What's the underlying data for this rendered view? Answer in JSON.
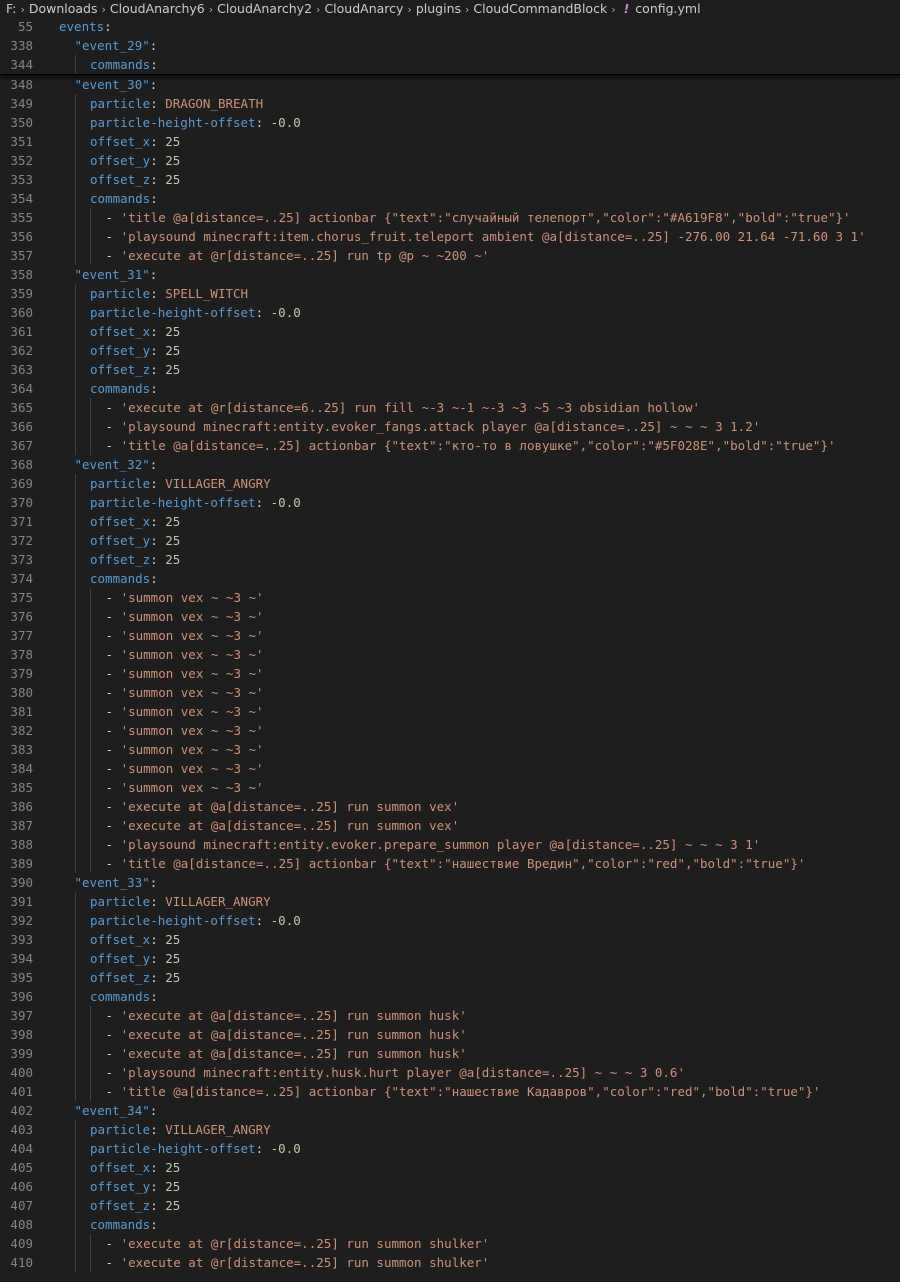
{
  "breadcrumb": {
    "items": [
      "F:",
      "Downloads",
      "CloudAnarchy6",
      "CloudAnarchy2",
      "CloudAnarcy",
      "plugins",
      "CloudCommandBlock"
    ],
    "file_icon": "!",
    "file_name": "config.yml"
  },
  "sticky_lines": [
    {
      "num": "55",
      "indent": 0,
      "parts": [
        {
          "t": "events",
          "c": "k"
        },
        {
          "t": ":",
          "c": "p"
        }
      ]
    },
    {
      "num": "338",
      "indent": 1,
      "parts": [
        {
          "t": "\"event_29\"",
          "c": "k"
        },
        {
          "t": ":",
          "c": "p"
        }
      ]
    },
    {
      "num": "344",
      "indent": 2,
      "parts": [
        {
          "t": "commands",
          "c": "k"
        },
        {
          "t": ":",
          "c": "p"
        }
      ]
    }
  ],
  "lines": [
    {
      "num": "348",
      "indent": 1,
      "parts": [
        {
          "t": "\"event_30\"",
          "c": "k"
        },
        {
          "t": ":",
          "c": "p"
        }
      ]
    },
    {
      "num": "349",
      "indent": 2,
      "parts": [
        {
          "t": "particle",
          "c": "k"
        },
        {
          "t": ": ",
          "c": "p"
        },
        {
          "t": "DRAGON_BREATH",
          "c": "s"
        }
      ]
    },
    {
      "num": "350",
      "indent": 2,
      "parts": [
        {
          "t": "particle-height-offset",
          "c": "k"
        },
        {
          "t": ": ",
          "c": "p"
        },
        {
          "t": "-0.0",
          "c": "n"
        }
      ]
    },
    {
      "num": "351",
      "indent": 2,
      "parts": [
        {
          "t": "offset_x",
          "c": "k"
        },
        {
          "t": ": ",
          "c": "p"
        },
        {
          "t": "25",
          "c": "n"
        }
      ]
    },
    {
      "num": "352",
      "indent": 2,
      "parts": [
        {
          "t": "offset_y",
          "c": "k"
        },
        {
          "t": ": ",
          "c": "p"
        },
        {
          "t": "25",
          "c": "n"
        }
      ]
    },
    {
      "num": "353",
      "indent": 2,
      "parts": [
        {
          "t": "offset_z",
          "c": "k"
        },
        {
          "t": ": ",
          "c": "p"
        },
        {
          "t": "25",
          "c": "n"
        }
      ]
    },
    {
      "num": "354",
      "indent": 2,
      "parts": [
        {
          "t": "commands",
          "c": "k"
        },
        {
          "t": ":",
          "c": "p"
        }
      ]
    },
    {
      "num": "355",
      "indent": 3,
      "parts": [
        {
          "t": "- ",
          "c": "p"
        },
        {
          "t": "'title @a[distance=..25] actionbar {\"text\":\"случайный телепорт\",\"color\":\"#A619F8\",\"bold\":\"true\"}'",
          "c": "s"
        }
      ]
    },
    {
      "num": "356",
      "indent": 3,
      "parts": [
        {
          "t": "- ",
          "c": "p"
        },
        {
          "t": "'playsound minecraft:item.chorus_fruit.teleport ambient @a[distance=..25] -276.00 21.64 -71.60 3 1'",
          "c": "s"
        }
      ]
    },
    {
      "num": "357",
      "indent": 3,
      "parts": [
        {
          "t": "- ",
          "c": "p"
        },
        {
          "t": "'execute at @r[distance=..25] run tp @p ~ ~200 ~'",
          "c": "s"
        }
      ]
    },
    {
      "num": "358",
      "indent": 1,
      "parts": [
        {
          "t": "\"event_31\"",
          "c": "k"
        },
        {
          "t": ":",
          "c": "p"
        }
      ]
    },
    {
      "num": "359",
      "indent": 2,
      "parts": [
        {
          "t": "particle",
          "c": "k"
        },
        {
          "t": ": ",
          "c": "p"
        },
        {
          "t": "SPELL_WITCH",
          "c": "s"
        }
      ]
    },
    {
      "num": "360",
      "indent": 2,
      "parts": [
        {
          "t": "particle-height-offset",
          "c": "k"
        },
        {
          "t": ": ",
          "c": "p"
        },
        {
          "t": "-0.0",
          "c": "n"
        }
      ]
    },
    {
      "num": "361",
      "indent": 2,
      "parts": [
        {
          "t": "offset_x",
          "c": "k"
        },
        {
          "t": ": ",
          "c": "p"
        },
        {
          "t": "25",
          "c": "n"
        }
      ]
    },
    {
      "num": "362",
      "indent": 2,
      "parts": [
        {
          "t": "offset_y",
          "c": "k"
        },
        {
          "t": ": ",
          "c": "p"
        },
        {
          "t": "25",
          "c": "n"
        }
      ]
    },
    {
      "num": "363",
      "indent": 2,
      "parts": [
        {
          "t": "offset_z",
          "c": "k"
        },
        {
          "t": ": ",
          "c": "p"
        },
        {
          "t": "25",
          "c": "n"
        }
      ]
    },
    {
      "num": "364",
      "indent": 2,
      "parts": [
        {
          "t": "commands",
          "c": "k"
        },
        {
          "t": ":",
          "c": "p"
        }
      ]
    },
    {
      "num": "365",
      "indent": 3,
      "parts": [
        {
          "t": "- ",
          "c": "p"
        },
        {
          "t": "'execute at @r[distance=6..25] run fill ~-3 ~-1 ~-3 ~3 ~5 ~3 obsidian hollow'",
          "c": "s"
        }
      ]
    },
    {
      "num": "366",
      "indent": 3,
      "parts": [
        {
          "t": "- ",
          "c": "p"
        },
        {
          "t": "'playsound minecraft:entity.evoker_fangs.attack player @a[distance=..25] ~ ~ ~ 3 1.2'",
          "c": "s"
        }
      ]
    },
    {
      "num": "367",
      "indent": 3,
      "parts": [
        {
          "t": "- ",
          "c": "p"
        },
        {
          "t": "'title @a[distance=..25] actionbar {\"text\":\"кто-то в ловушке\",\"color\":\"#5F028E\",\"bold\":\"true\"}'",
          "c": "s"
        }
      ]
    },
    {
      "num": "368",
      "indent": 1,
      "parts": [
        {
          "t": "\"event_32\"",
          "c": "k"
        },
        {
          "t": ":",
          "c": "p"
        }
      ]
    },
    {
      "num": "369",
      "indent": 2,
      "parts": [
        {
          "t": "particle",
          "c": "k"
        },
        {
          "t": ": ",
          "c": "p"
        },
        {
          "t": "VILLAGER_ANGRY",
          "c": "s"
        }
      ]
    },
    {
      "num": "370",
      "indent": 2,
      "parts": [
        {
          "t": "particle-height-offset",
          "c": "k"
        },
        {
          "t": ": ",
          "c": "p"
        },
        {
          "t": "-0.0",
          "c": "n"
        }
      ]
    },
    {
      "num": "371",
      "indent": 2,
      "parts": [
        {
          "t": "offset_x",
          "c": "k"
        },
        {
          "t": ": ",
          "c": "p"
        },
        {
          "t": "25",
          "c": "n"
        }
      ]
    },
    {
      "num": "372",
      "indent": 2,
      "parts": [
        {
          "t": "offset_y",
          "c": "k"
        },
        {
          "t": ": ",
          "c": "p"
        },
        {
          "t": "25",
          "c": "n"
        }
      ]
    },
    {
      "num": "373",
      "indent": 2,
      "parts": [
        {
          "t": "offset_z",
          "c": "k"
        },
        {
          "t": ": ",
          "c": "p"
        },
        {
          "t": "25",
          "c": "n"
        }
      ]
    },
    {
      "num": "374",
      "indent": 2,
      "parts": [
        {
          "t": "commands",
          "c": "k"
        },
        {
          "t": ":",
          "c": "p"
        }
      ]
    },
    {
      "num": "375",
      "indent": 3,
      "parts": [
        {
          "t": "- ",
          "c": "p"
        },
        {
          "t": "'summon vex ~ ~3 ~'",
          "c": "s"
        }
      ]
    },
    {
      "num": "376",
      "indent": 3,
      "parts": [
        {
          "t": "- ",
          "c": "p"
        },
        {
          "t": "'summon vex ~ ~3 ~'",
          "c": "s"
        }
      ]
    },
    {
      "num": "377",
      "indent": 3,
      "parts": [
        {
          "t": "- ",
          "c": "p"
        },
        {
          "t": "'summon vex ~ ~3 ~'",
          "c": "s"
        }
      ]
    },
    {
      "num": "378",
      "indent": 3,
      "parts": [
        {
          "t": "- ",
          "c": "p"
        },
        {
          "t": "'summon vex ~ ~3 ~'",
          "c": "s"
        }
      ]
    },
    {
      "num": "379",
      "indent": 3,
      "parts": [
        {
          "t": "- ",
          "c": "p"
        },
        {
          "t": "'summon vex ~ ~3 ~'",
          "c": "s"
        }
      ]
    },
    {
      "num": "380",
      "indent": 3,
      "parts": [
        {
          "t": "- ",
          "c": "p"
        },
        {
          "t": "'summon vex ~ ~3 ~'",
          "c": "s"
        }
      ]
    },
    {
      "num": "381",
      "indent": 3,
      "parts": [
        {
          "t": "- ",
          "c": "p"
        },
        {
          "t": "'summon vex ~ ~3 ~'",
          "c": "s"
        }
      ]
    },
    {
      "num": "382",
      "indent": 3,
      "parts": [
        {
          "t": "- ",
          "c": "p"
        },
        {
          "t": "'summon vex ~ ~3 ~'",
          "c": "s"
        }
      ]
    },
    {
      "num": "383",
      "indent": 3,
      "parts": [
        {
          "t": "- ",
          "c": "p"
        },
        {
          "t": "'summon vex ~ ~3 ~'",
          "c": "s"
        }
      ]
    },
    {
      "num": "384",
      "indent": 3,
      "parts": [
        {
          "t": "- ",
          "c": "p"
        },
        {
          "t": "'summon vex ~ ~3 ~'",
          "c": "s"
        }
      ]
    },
    {
      "num": "385",
      "indent": 3,
      "parts": [
        {
          "t": "- ",
          "c": "p"
        },
        {
          "t": "'summon vex ~ ~3 ~'",
          "c": "s"
        }
      ]
    },
    {
      "num": "386",
      "indent": 3,
      "parts": [
        {
          "t": "- ",
          "c": "p"
        },
        {
          "t": "'execute at @a[distance=..25] run summon vex'",
          "c": "s"
        }
      ]
    },
    {
      "num": "387",
      "indent": 3,
      "parts": [
        {
          "t": "- ",
          "c": "p"
        },
        {
          "t": "'execute at @a[distance=..25] run summon vex'",
          "c": "s"
        }
      ]
    },
    {
      "num": "388",
      "indent": 3,
      "parts": [
        {
          "t": "- ",
          "c": "p"
        },
        {
          "t": "'playsound minecraft:entity.evoker.prepare_summon player @a[distance=..25] ~ ~ ~ 3 1'",
          "c": "s"
        }
      ]
    },
    {
      "num": "389",
      "indent": 3,
      "parts": [
        {
          "t": "- ",
          "c": "p"
        },
        {
          "t": "'title @a[distance=..25] actionbar {\"text\":\"нашествие Вредин\",\"color\":\"red\",\"bold\":\"true\"}'",
          "c": "s"
        }
      ]
    },
    {
      "num": "390",
      "indent": 1,
      "parts": [
        {
          "t": "\"event_33\"",
          "c": "k"
        },
        {
          "t": ":",
          "c": "p"
        }
      ]
    },
    {
      "num": "391",
      "indent": 2,
      "parts": [
        {
          "t": "particle",
          "c": "k"
        },
        {
          "t": ": ",
          "c": "p"
        },
        {
          "t": "VILLAGER_ANGRY",
          "c": "s"
        }
      ]
    },
    {
      "num": "392",
      "indent": 2,
      "parts": [
        {
          "t": "particle-height-offset",
          "c": "k"
        },
        {
          "t": ": ",
          "c": "p"
        },
        {
          "t": "-0.0",
          "c": "n"
        }
      ]
    },
    {
      "num": "393",
      "indent": 2,
      "parts": [
        {
          "t": "offset_x",
          "c": "k"
        },
        {
          "t": ": ",
          "c": "p"
        },
        {
          "t": "25",
          "c": "n"
        }
      ]
    },
    {
      "num": "394",
      "indent": 2,
      "parts": [
        {
          "t": "offset_y",
          "c": "k"
        },
        {
          "t": ": ",
          "c": "p"
        },
        {
          "t": "25",
          "c": "n"
        }
      ]
    },
    {
      "num": "395",
      "indent": 2,
      "parts": [
        {
          "t": "offset_z",
          "c": "k"
        },
        {
          "t": ": ",
          "c": "p"
        },
        {
          "t": "25",
          "c": "n"
        }
      ]
    },
    {
      "num": "396",
      "indent": 2,
      "parts": [
        {
          "t": "commands",
          "c": "k"
        },
        {
          "t": ":",
          "c": "p"
        }
      ]
    },
    {
      "num": "397",
      "indent": 3,
      "parts": [
        {
          "t": "- ",
          "c": "p"
        },
        {
          "t": "'execute at @a[distance=..25] run summon husk'",
          "c": "s"
        }
      ]
    },
    {
      "num": "398",
      "indent": 3,
      "parts": [
        {
          "t": "- ",
          "c": "p"
        },
        {
          "t": "'execute at @a[distance=..25] run summon husk'",
          "c": "s"
        }
      ]
    },
    {
      "num": "399",
      "indent": 3,
      "parts": [
        {
          "t": "- ",
          "c": "p"
        },
        {
          "t": "'execute at @a[distance=..25] run summon husk'",
          "c": "s"
        }
      ]
    },
    {
      "num": "400",
      "indent": 3,
      "parts": [
        {
          "t": "- ",
          "c": "p"
        },
        {
          "t": "'playsound minecraft:entity.husk.hurt player @a[distance=..25] ~ ~ ~ 3 0.6'",
          "c": "s"
        }
      ]
    },
    {
      "num": "401",
      "indent": 3,
      "parts": [
        {
          "t": "- ",
          "c": "p"
        },
        {
          "t": "'title @a[distance=..25] actionbar {\"text\":\"нашествие Кадавров\",\"color\":\"red\",\"bold\":\"true\"}'",
          "c": "s"
        }
      ]
    },
    {
      "num": "402",
      "indent": 1,
      "parts": [
        {
          "t": "\"event_34\"",
          "c": "k"
        },
        {
          "t": ":",
          "c": "p"
        }
      ]
    },
    {
      "num": "403",
      "indent": 2,
      "parts": [
        {
          "t": "particle",
          "c": "k"
        },
        {
          "t": ": ",
          "c": "p"
        },
        {
          "t": "VILLAGER_ANGRY",
          "c": "s"
        }
      ]
    },
    {
      "num": "404",
      "indent": 2,
      "parts": [
        {
          "t": "particle-height-offset",
          "c": "k"
        },
        {
          "t": ": ",
          "c": "p"
        },
        {
          "t": "-0.0",
          "c": "n"
        }
      ]
    },
    {
      "num": "405",
      "indent": 2,
      "parts": [
        {
          "t": "offset_x",
          "c": "k"
        },
        {
          "t": ": ",
          "c": "p"
        },
        {
          "t": "25",
          "c": "n"
        }
      ]
    },
    {
      "num": "406",
      "indent": 2,
      "parts": [
        {
          "t": "offset_y",
          "c": "k"
        },
        {
          "t": ": ",
          "c": "p"
        },
        {
          "t": "25",
          "c": "n"
        }
      ]
    },
    {
      "num": "407",
      "indent": 2,
      "parts": [
        {
          "t": "offset_z",
          "c": "k"
        },
        {
          "t": ": ",
          "c": "p"
        },
        {
          "t": "25",
          "c": "n"
        }
      ]
    },
    {
      "num": "408",
      "indent": 2,
      "parts": [
        {
          "t": "commands",
          "c": "k"
        },
        {
          "t": ":",
          "c": "p"
        }
      ]
    },
    {
      "num": "409",
      "indent": 3,
      "parts": [
        {
          "t": "- ",
          "c": "p"
        },
        {
          "t": "'execute at @r[distance=..25] run summon shulker'",
          "c": "s"
        }
      ]
    },
    {
      "num": "410",
      "indent": 3,
      "parts": [
        {
          "t": "- ",
          "c": "p"
        },
        {
          "t": "'execute at @r[distance=..25] run summon shulker'",
          "c": "s"
        }
      ]
    }
  ],
  "colors": {
    "background": "#1e1e1e",
    "key": "#569cd6",
    "string": "#ce9178",
    "number": "#b5cea8",
    "line_number": "#858585",
    "indent_guide": "#404040"
  }
}
